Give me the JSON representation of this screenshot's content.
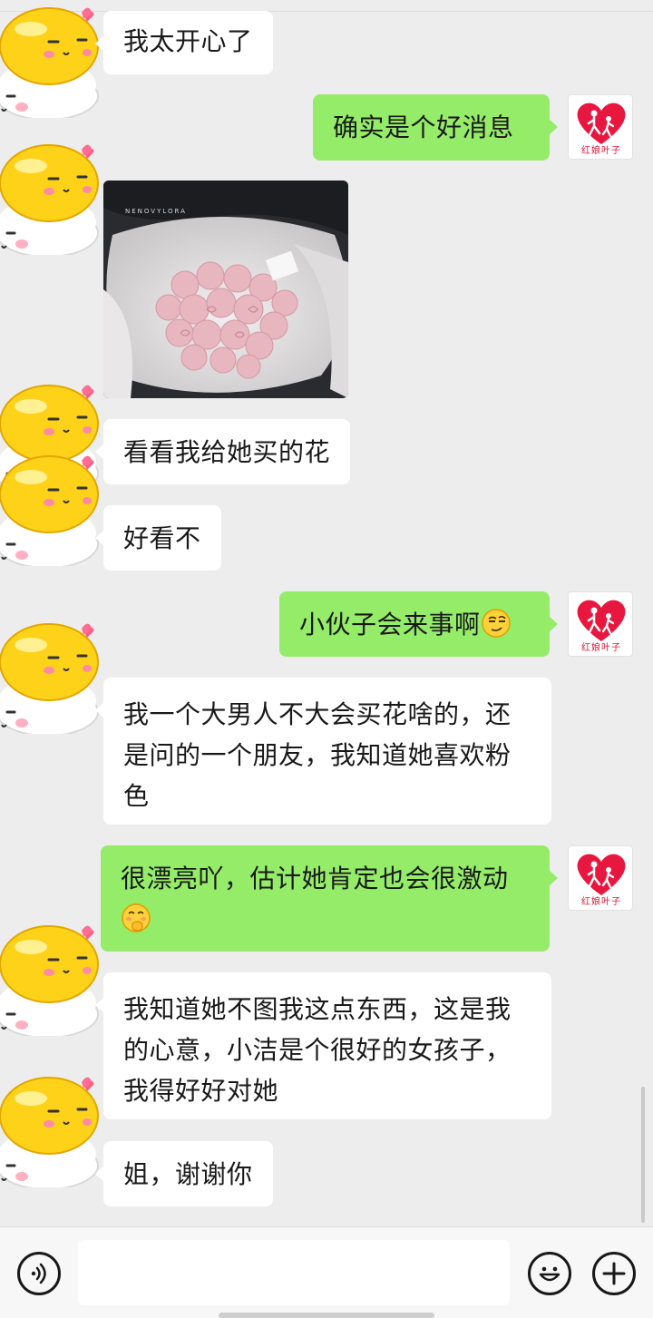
{
  "right_avatar_caption": "红娘叶子",
  "photo_brand": "NENOVYLORA",
  "messages": [
    {
      "side": "left",
      "text": "我太开心了"
    },
    {
      "side": "right",
      "text": "确实是个好消息"
    },
    {
      "side": "left",
      "type": "image",
      "alt": "pink roses bouquet"
    },
    {
      "side": "left",
      "text": "看看我给她买的花"
    },
    {
      "side": "left",
      "text": "好看不"
    },
    {
      "side": "right",
      "text": "小伙子会来事啊",
      "emoji": "smirk-emoji"
    },
    {
      "side": "left",
      "text": "我一个大男人不大会买花啥的，还是问的一个朋友，我知道她喜欢粉色"
    },
    {
      "side": "right",
      "text": "很漂亮吖，估计她肯定也会很激动",
      "emoji": "blush-hand-emoji"
    },
    {
      "side": "left",
      "text": "我知道她不图我这点东西，这是我的心意，小洁是个很好的女孩子，我得好好对她"
    },
    {
      "side": "left",
      "text": "姐，谢谢你"
    }
  ],
  "input_bar": {
    "placeholder": "",
    "icons": [
      "voice-icon",
      "emoji-icon",
      "plus-icon"
    ]
  },
  "colors": {
    "background": "#ededed",
    "bubble_right": "#95ec69",
    "bubble_left": "#ffffff",
    "avatar_heart": "#e8173f"
  }
}
